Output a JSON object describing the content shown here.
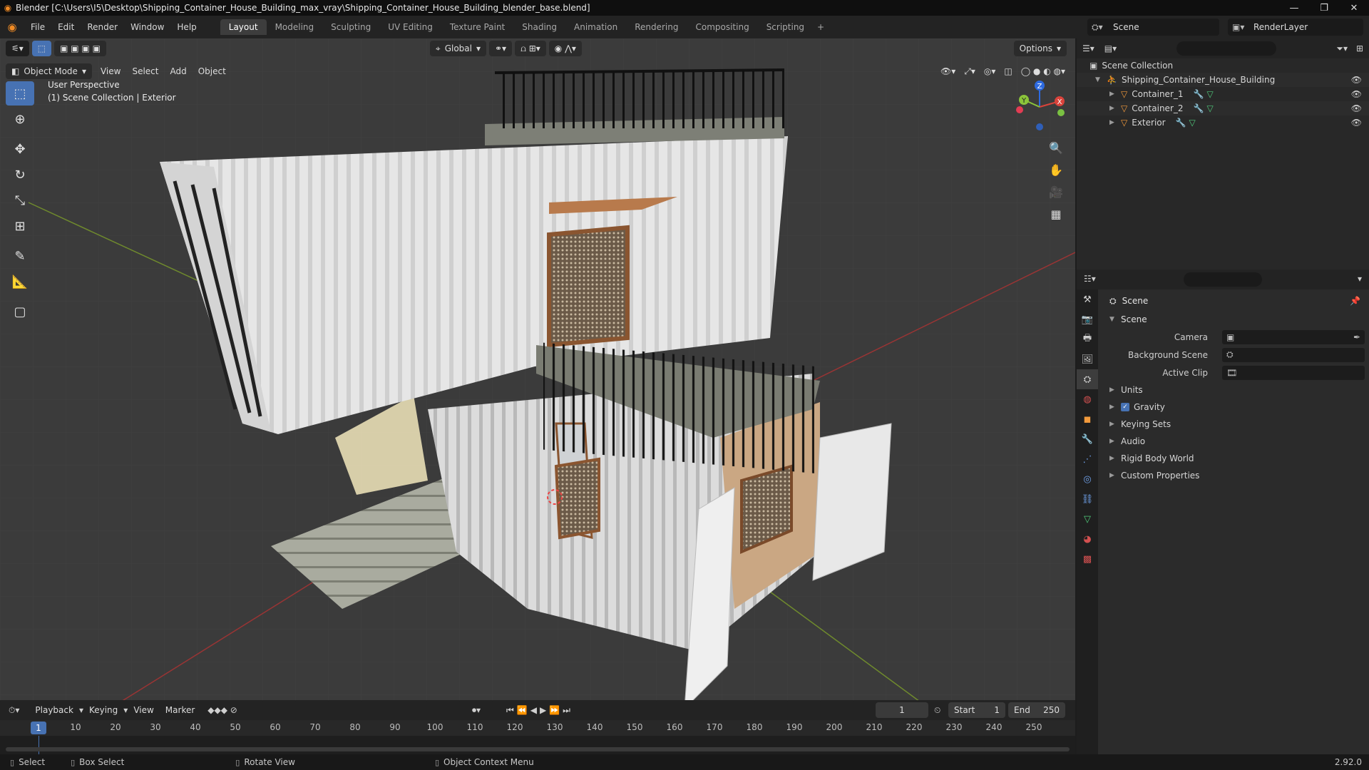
{
  "window": {
    "title": "Blender [C:\\Users\\I5\\Desktop\\Shipping_Container_House_Building_max_vray\\Shipping_Container_House_Building_blender_base.blend]",
    "controls": [
      "—",
      "❐",
      "✕"
    ]
  },
  "menu": [
    "File",
    "Edit",
    "Render",
    "Window",
    "Help"
  ],
  "workspaces": [
    "Layout",
    "Modeling",
    "Sculpting",
    "UV Editing",
    "Texture Paint",
    "Shading",
    "Animation",
    "Rendering",
    "Compositing",
    "Scripting"
  ],
  "scene_name": "Scene",
  "render_layer": "RenderLayer",
  "viewport": {
    "mode": "Object Mode",
    "menus": [
      "View",
      "Select",
      "Add",
      "Object"
    ],
    "transform_orientation": "Global",
    "options_label": "Options",
    "perspective_label": "User Perspective",
    "collection_label": "(1) Scene Collection | Exterior"
  },
  "outliner": {
    "root": "Scene Collection",
    "collection": "Shipping_Container_House_Building",
    "objects": [
      "Container_1",
      "Container_2",
      "Exterior"
    ]
  },
  "properties": {
    "title": "Scene",
    "panel": "Scene",
    "fields": [
      {
        "label": "Camera",
        "value": ""
      },
      {
        "label": "Background Scene",
        "value": ""
      },
      {
        "label": "Active Clip",
        "value": ""
      }
    ],
    "sections": [
      "Units",
      "Gravity",
      "Keying Sets",
      "Audio",
      "Rigid Body World",
      "Custom Properties"
    ]
  },
  "timeline": {
    "menus": [
      "Playback",
      "Keying",
      "View",
      "Marker"
    ],
    "current_frame": "1",
    "start_label": "Start",
    "start": "1",
    "end_label": "End",
    "end": "250",
    "ticks": [
      "1",
      "10",
      "20",
      "30",
      "40",
      "50",
      "60",
      "70",
      "80",
      "90",
      "100",
      "110",
      "120",
      "130",
      "140",
      "150",
      "160",
      "170",
      "180",
      "190",
      "200",
      "210",
      "220",
      "230",
      "240",
      "250"
    ]
  },
  "statusbar": {
    "items": [
      "Select",
      "Box Select",
      "Rotate View",
      "Object Context Menu"
    ],
    "version": "2.92.0"
  }
}
